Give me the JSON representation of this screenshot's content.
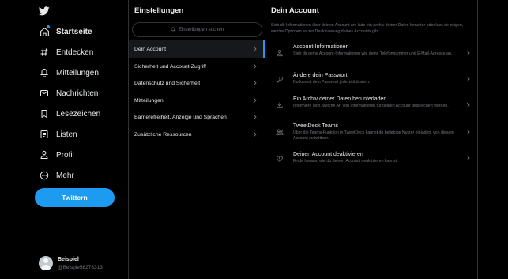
{
  "nav": {
    "logo": "twitter-bird-icon",
    "items": [
      {
        "label": "Startseite",
        "icon": "home-icon"
      },
      {
        "label": "Entdecken",
        "icon": "hashtag-icon"
      },
      {
        "label": "Mitteilungen",
        "icon": "bell-icon"
      },
      {
        "label": "Nachrichten",
        "icon": "envelope-icon"
      },
      {
        "label": "Lesezeichen",
        "icon": "bookmark-icon"
      },
      {
        "label": "Listen",
        "icon": "list-icon"
      },
      {
        "label": "Profil",
        "icon": "person-icon"
      },
      {
        "label": "Mehr",
        "icon": "more-circle-icon"
      }
    ],
    "tweet_button": "Twittern",
    "profile": {
      "name": "Beispiel",
      "handle": "@Beispie58278313",
      "more": "···"
    }
  },
  "settings": {
    "title": "Einstellungen",
    "search_placeholder": "Einstellungen suchen",
    "items": [
      {
        "label": "Dein Account",
        "selected": true
      },
      {
        "label": "Sicherheit und Account-Zugriff"
      },
      {
        "label": "Datenschutz und Sicherheit"
      },
      {
        "label": "Mitteilungen"
      },
      {
        "label": "Barrierefreiheit, Anzeige und Sprachen"
      },
      {
        "label": "Zusätzliche Ressourcen"
      }
    ]
  },
  "account": {
    "title": "Dein Account",
    "intro": "Sieh dir Informationen über deinen Account an, lade ein Archiv deiner Daten herunter oder lass dir zeigen, welche Optionen es zur Deaktivierung deines Accounts gibt",
    "items": [
      {
        "title": "Account-Informationen",
        "desc": "Sieh dir deine Account-Informationen wie deine Telefonnummer und E-Mail-Adresse an.",
        "icon": "person-icon"
      },
      {
        "title": "Ändere dein Passwort",
        "desc": "Du kannst dein Passwort jederzeit ändern.",
        "icon": "key-icon"
      },
      {
        "title": "Ein Archiv deiner Daten herunterladen",
        "desc": "Informiere dich, welche Art von Informationen für deinen Account gespeichert werden.",
        "icon": "download-icon"
      },
      {
        "title": "TweetDeck Teams",
        "desc": "Über die Teams-Funktion in TweetDeck kannst du beliebige Nutzer einladen, von diesem Account zu twittern.",
        "icon": "people-icon"
      },
      {
        "title": "Deinen Account deaktivieren",
        "desc": "Finde heraus, wie du deinen Account deaktivieren kannst.",
        "icon": "broken-heart-icon"
      }
    ]
  },
  "colors": {
    "accent": "#1d9bf0",
    "background": "#000000",
    "border": "#2f3336",
    "muted": "#71767b",
    "text": "#e7e9ea"
  }
}
